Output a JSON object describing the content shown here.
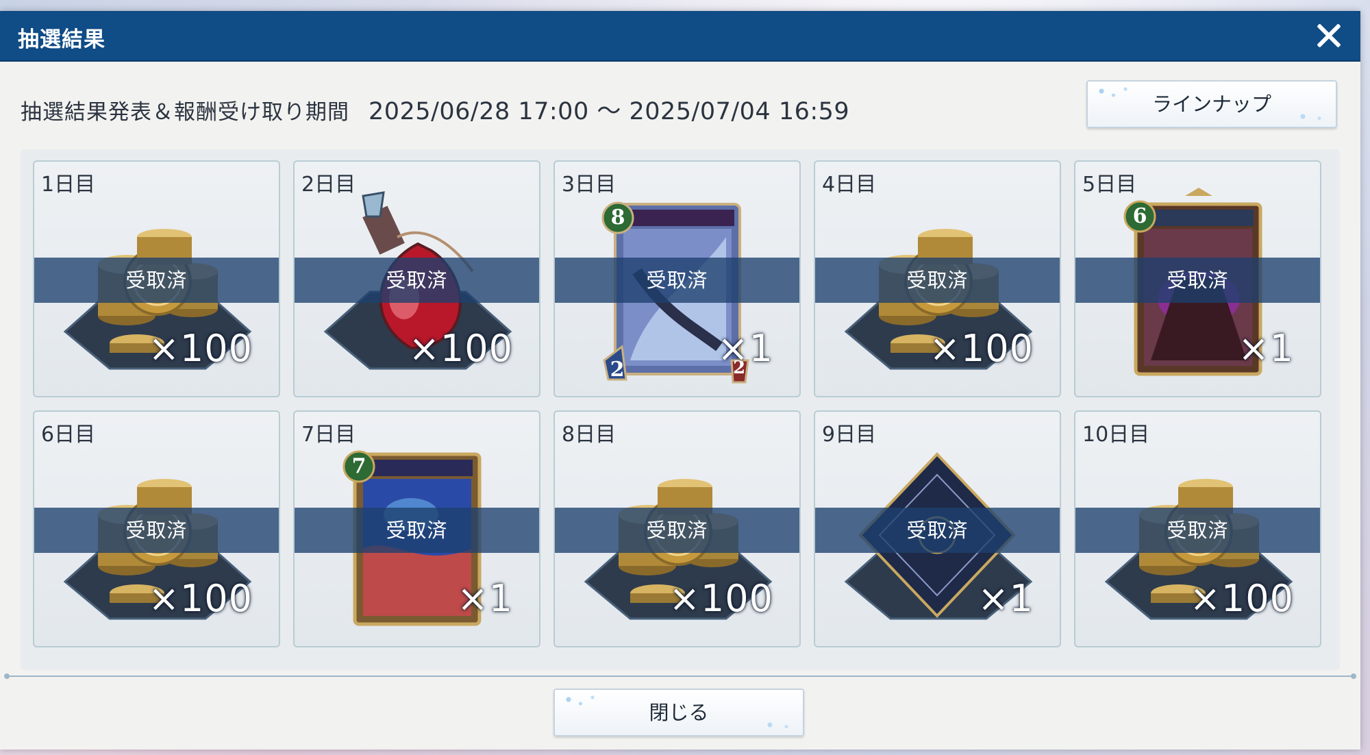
{
  "dialog": {
    "title": "抽選結果",
    "close_icon": "close-x-icon"
  },
  "period": {
    "label": "抽選結果発表＆報酬受け取り期間",
    "range": "2025/06/28 17:00 ～ 2025/07/04 16:59"
  },
  "buttons": {
    "lineup": "ラインナップ",
    "close": "閉じる"
  },
  "rewards": [
    {
      "day": "1日目",
      "status": "受取済",
      "qty": "×100",
      "item": "coins"
    },
    {
      "day": "2日目",
      "status": "受取済",
      "qty": "×100",
      "item": "potion"
    },
    {
      "day": "3日目",
      "status": "受取済",
      "qty": "×1",
      "item": "card",
      "cost": "8",
      "atk": "2",
      "hp": "2"
    },
    {
      "day": "4日目",
      "status": "受取済",
      "qty": "×100",
      "item": "coins"
    },
    {
      "day": "5日目",
      "status": "受取済",
      "qty": "×1",
      "item": "card",
      "cost": "6"
    },
    {
      "day": "6日目",
      "status": "受取済",
      "qty": "×100",
      "item": "coins"
    },
    {
      "day": "7日目",
      "status": "受取済",
      "qty": "×1",
      "item": "card",
      "cost": "7"
    },
    {
      "day": "8日目",
      "status": "受取済",
      "qty": "×100",
      "item": "coins"
    },
    {
      "day": "9日目",
      "status": "受取済",
      "qty": "×1",
      "item": "sleeve"
    },
    {
      "day": "10日目",
      "status": "受取済",
      "qty": "×100",
      "item": "coins"
    }
  ],
  "colors": {
    "titlebar": "#104c86",
    "band": "#1e406e",
    "panel": "#f2f2f0"
  }
}
